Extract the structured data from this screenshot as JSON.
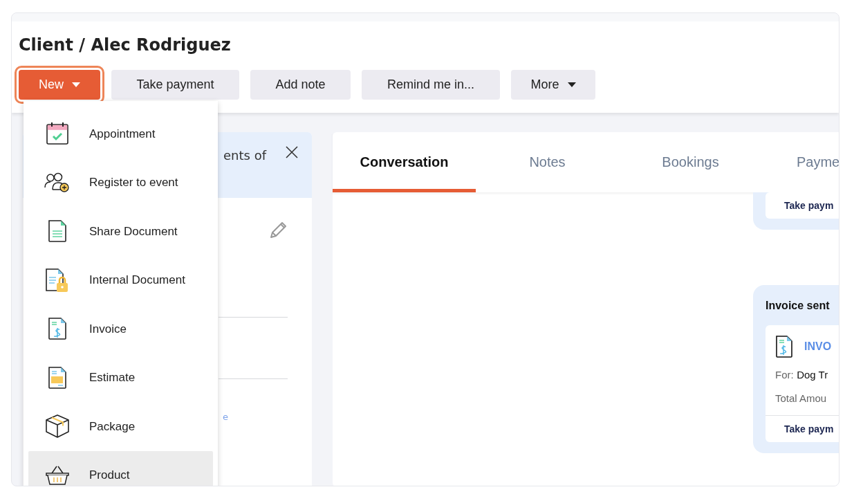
{
  "page": {
    "title": "Client / Alec Rodriguez"
  },
  "actions": [
    {
      "label": "New",
      "kind": "primary",
      "caret": true
    },
    {
      "label": "Take payment",
      "kind": "secondary",
      "caret": false
    },
    {
      "label": "Add note",
      "kind": "secondary",
      "caret": false
    },
    {
      "label": "Remind me in...",
      "kind": "secondary",
      "caret": false
    },
    {
      "label": "More",
      "kind": "secondary",
      "caret": true
    }
  ],
  "new_menu": [
    {
      "label": "Appointment",
      "highlighted": false
    },
    {
      "label": "Register to event",
      "highlighted": false
    },
    {
      "label": "Share Document",
      "highlighted": false
    },
    {
      "label": "Internal Document",
      "highlighted": false
    },
    {
      "label": "Invoice",
      "highlighted": false
    },
    {
      "label": "Estimate",
      "highlighted": false
    },
    {
      "label": "Package",
      "highlighted": false
    },
    {
      "label": "Product",
      "highlighted": true
    }
  ],
  "side_panel": {
    "header_text": "ents of",
    "link_text": "e"
  },
  "tabs": [
    {
      "label": "Conversation",
      "selected": true
    },
    {
      "label": "Notes",
      "selected": false
    },
    {
      "label": "Bookings",
      "selected": false
    },
    {
      "label": "Payme",
      "selected": false
    }
  ],
  "conversation": {
    "first_card": {
      "action": "Take paym"
    },
    "invoice_card": {
      "title": "Invoice sent",
      "invoice_link": "INVO",
      "for_label": "For:",
      "for_value": "Dog Tr",
      "total_label": "Total Amou",
      "action": "Take paym"
    }
  }
}
